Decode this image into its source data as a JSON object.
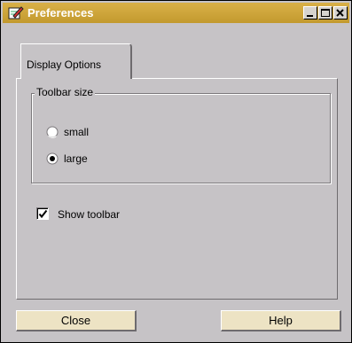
{
  "window": {
    "title": "Preferences"
  },
  "title_buttons": [
    "minimize-icon",
    "maximize-icon",
    "close-icon"
  ],
  "tabs": [
    {
      "label": "Display Options",
      "selected": true
    }
  ],
  "toolbar_size": {
    "legend": "Toolbar size",
    "options": [
      {
        "label": "small",
        "selected": false
      },
      {
        "label": "large",
        "selected": true
      }
    ]
  },
  "show_toolbar": {
    "label": "Show toolbar",
    "checked": true
  },
  "buttons": {
    "close": "Close",
    "help": "Help"
  },
  "colors": {
    "titlebar": "#c9a33a",
    "window_bg": "#c6c3c6",
    "button_bg": "#ede3c4"
  }
}
